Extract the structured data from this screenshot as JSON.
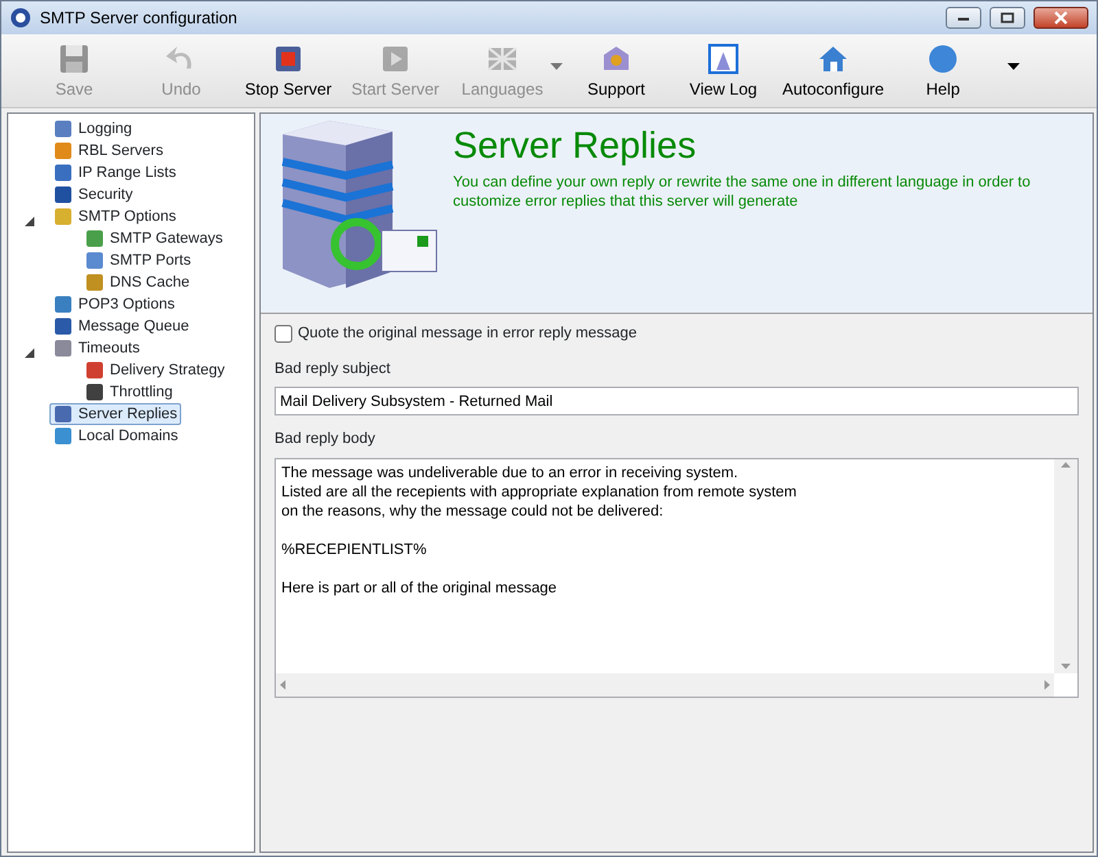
{
  "window": {
    "title": "SMTP Server configuration"
  },
  "toolbar": [
    {
      "label": "Save",
      "disabled": true
    },
    {
      "label": "Undo",
      "disabled": true
    },
    {
      "label": "Stop Server",
      "disabled": false
    },
    {
      "label": "Start Server",
      "disabled": true
    },
    {
      "label": "Languages",
      "disabled": true,
      "dropdown": true
    },
    {
      "label": "Support",
      "disabled": false
    },
    {
      "label": "View Log",
      "disabled": false
    },
    {
      "label": "Autoconfigure",
      "disabled": false
    },
    {
      "label": "Help",
      "disabled": false
    }
  ],
  "tree": [
    {
      "label": "Logging",
      "selected": false
    },
    {
      "label": "RBL Servers",
      "selected": false
    },
    {
      "label": "IP Range Lists",
      "selected": false
    },
    {
      "label": "Security",
      "selected": false
    },
    {
      "label": "SMTP Options",
      "selected": false,
      "expanded": true,
      "children": [
        {
          "label": "SMTP Gateways",
          "selected": false
        },
        {
          "label": "SMTP Ports",
          "selected": false
        },
        {
          "label": "DNS Cache",
          "selected": false
        }
      ]
    },
    {
      "label": "POP3 Options",
      "selected": false
    },
    {
      "label": "Message Queue",
      "selected": false
    },
    {
      "label": "Timeouts",
      "selected": false,
      "expanded": true,
      "children": [
        {
          "label": "Delivery Strategy",
          "selected": false
        },
        {
          "label": "Throttling",
          "selected": false
        }
      ]
    },
    {
      "label": "Server Replies",
      "selected": true
    },
    {
      "label": "Local Domains",
      "selected": false
    }
  ],
  "header": {
    "title": "Server Replies",
    "description": "You can define your own reply or rewrite the same one in different language in order to customize error replies that this server will generate"
  },
  "quote_checkbox": {
    "label": "Quote the original message in error reply message",
    "checked": false
  },
  "subject": {
    "label": "Bad reply subject",
    "value": "Mail Delivery Subsystem - Returned Mail"
  },
  "body": {
    "label": "Bad reply body",
    "value": "The message was undeliverable due to an error in receiving system.\nListed are all the recepients with appropriate explanation from remote system\non the reasons, why the message could not be delivered:\n\n%RECEPIENTLIST%\n\nHere is part or all of the original message"
  }
}
